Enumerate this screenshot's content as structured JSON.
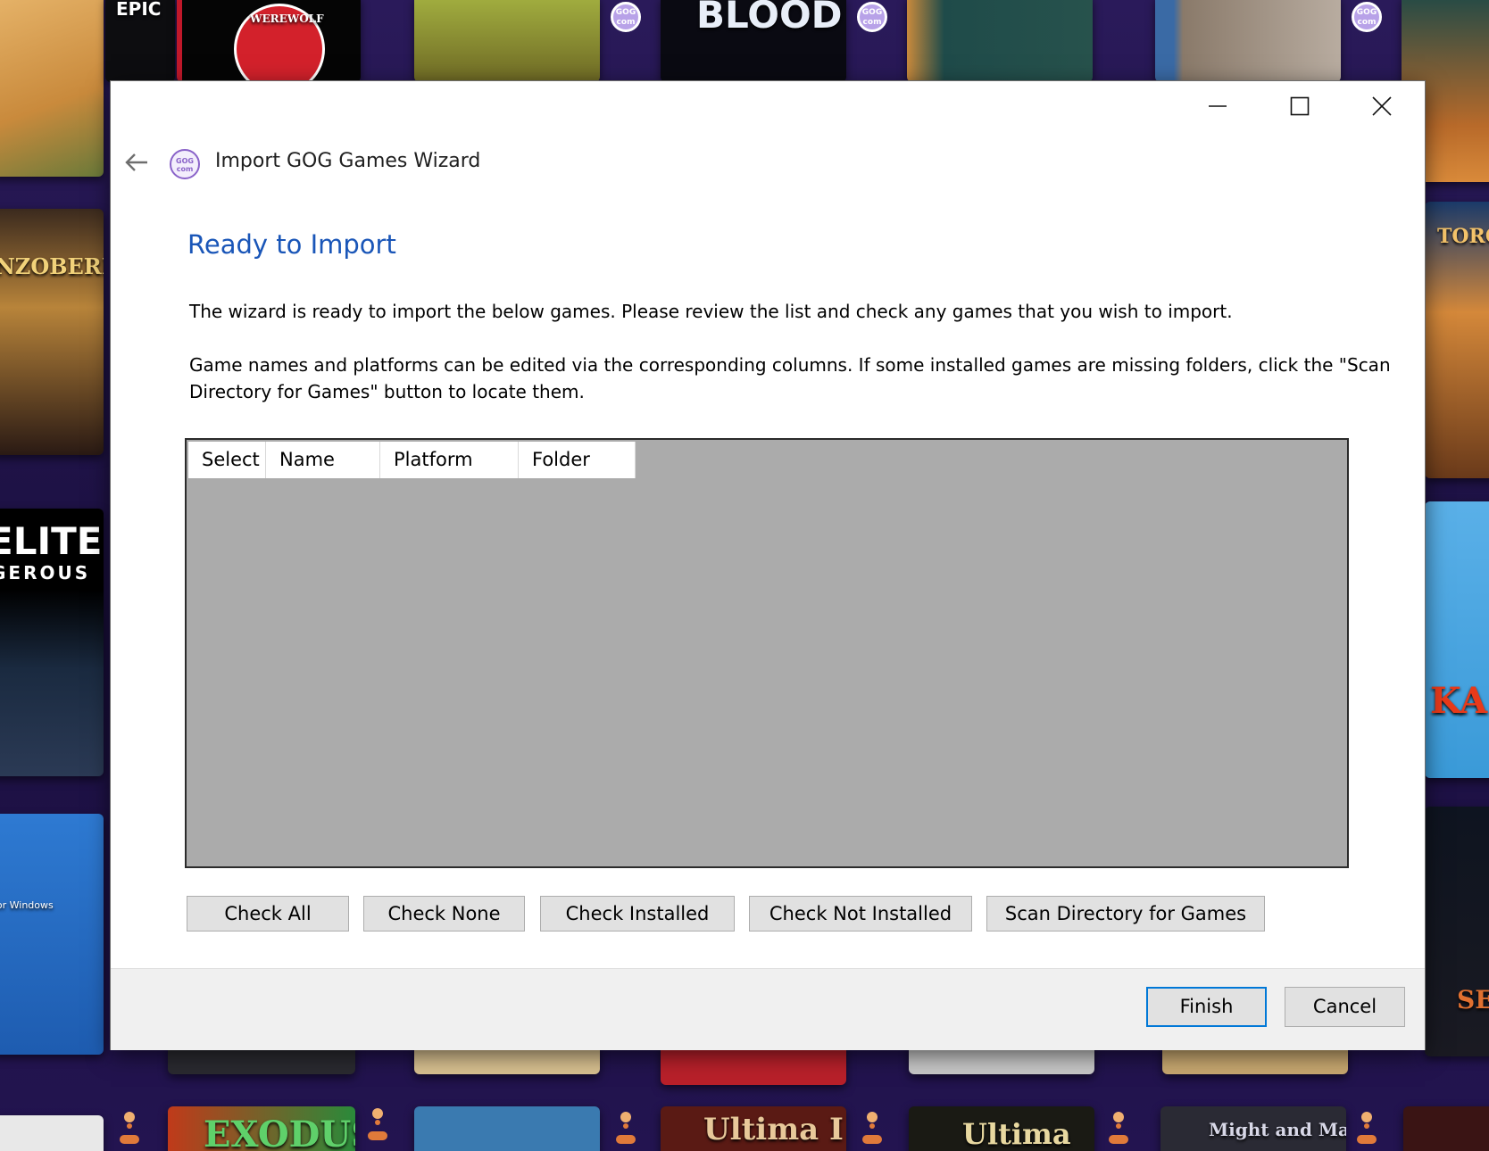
{
  "background": {
    "tiles": [
      {
        "label": "EPIC"
      },
      {
        "label": "WEREWOLF"
      },
      {
        "label": "BLOOD"
      },
      {
        "label": "MENZOBERRANZAN"
      },
      {
        "label": "ELITE"
      },
      {
        "label": "GEROUS"
      },
      {
        "label": "TORCHLIGHT"
      },
      {
        "label": "KA"
      },
      {
        "label": "EXODUS"
      },
      {
        "label": "Ultima I"
      },
      {
        "label": "Ultima"
      },
      {
        "label": "Might and Magic"
      },
      {
        "label": "SE"
      },
      {
        "label": "for Windows"
      }
    ]
  },
  "window": {
    "title": "Import GOG Games Wizard",
    "icon": "gog-icon",
    "icon_text": "GOG com",
    "controls": [
      "minimize-icon",
      "maximize-icon",
      "close-icon"
    ]
  },
  "content": {
    "heading": "Ready to Import",
    "paragraph1": "The wizard is ready to import the below games. Please review the list and check any games that you wish to import.",
    "paragraph2": "Game names and platforms can be edited via the corresponding columns. If some installed games are missing folders, click the \"Scan Directory for Games\" button to locate them."
  },
  "list": {
    "columns": [
      "Select",
      "Name",
      "Platform",
      "Folder"
    ],
    "rows": []
  },
  "actions": {
    "check_all": "Check All",
    "check_none": "Check None",
    "check_installed": "Check Installed",
    "check_not_installed": "Check Not Installed",
    "scan_directory": "Scan Directory for Games"
  },
  "footer": {
    "finish": "Finish",
    "cancel": "Cancel"
  },
  "colors": {
    "heading": "#1a56b8",
    "list_background": "#ababab",
    "accent": "#0078d7"
  }
}
